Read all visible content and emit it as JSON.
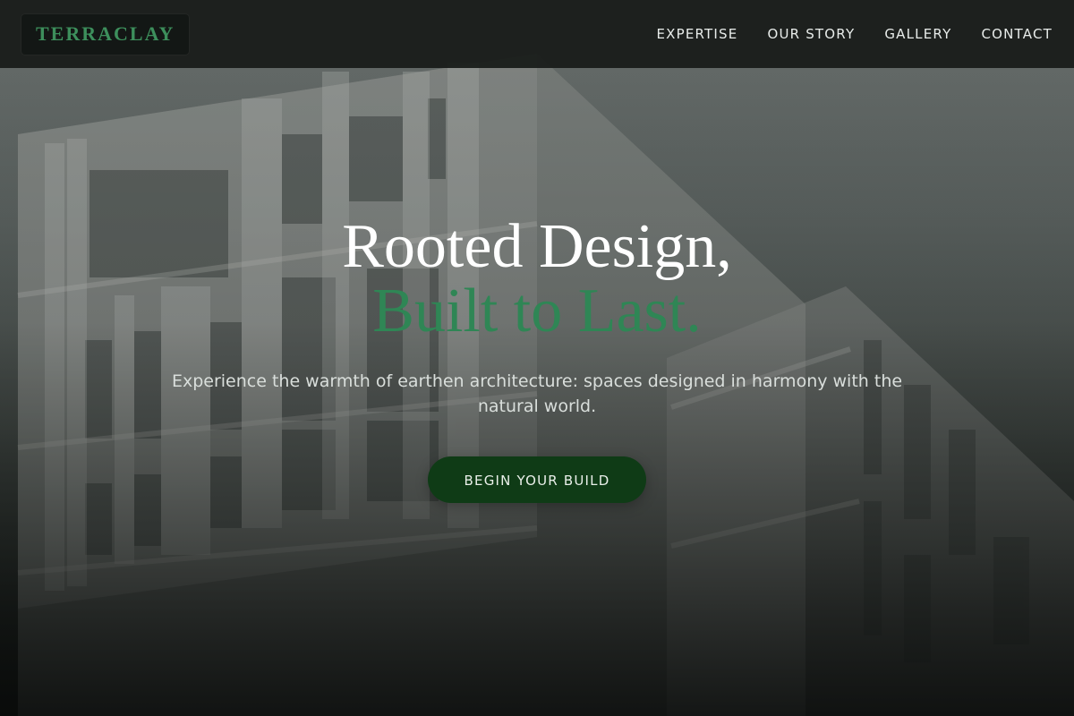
{
  "nav": {
    "logo": "TERRACLAY",
    "links": [
      "EXPERTISE",
      "OUR STORY",
      "GALLERY",
      "CONTACT"
    ]
  },
  "hero": {
    "headline_line1": "Rooted Design,",
    "headline_line2": "Built to Last.",
    "subtitle": "Experience the warmth of earthen architecture: spaces designed in harmony with the natural world.",
    "cta_label": "BEGIN YOUR BUILD",
    "background": "building-facade-photo"
  },
  "colors": {
    "accent_green": "#2f8655",
    "cta_background": "#0f3b16",
    "nav_background": "#181c1a"
  }
}
